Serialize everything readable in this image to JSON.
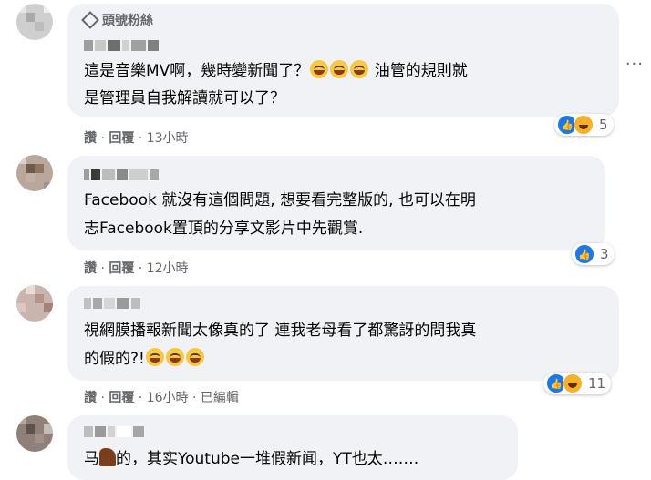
{
  "comments": [
    {
      "badge_label": "頭號粉絲",
      "line1": "這是音樂MV啊，幾時變新聞了？",
      "line1_tail": " 油管的規則就",
      "line2": "是管理員自我解讀就可以了？",
      "like_label": "讚",
      "reply_label": "回覆",
      "time": "13小時",
      "reaction_count": "5"
    },
    {
      "line1": "Facebook 就沒有這個問題, 想要看完整版的, 也可以在明",
      "line2": "志Facebook置頂的分享文影片中先觀賞.",
      "like_label": "讚",
      "reply_label": "回覆",
      "time": "12小時",
      "reaction_count": "3"
    },
    {
      "line1": "視網膜播報新聞太像真的了 連我老母看了都驚訝的問我真",
      "line2": "的假的?!",
      "like_label": "讚",
      "reply_label": "回覆",
      "time": "16小時",
      "edited": "已編輯",
      "reaction_count": "11"
    },
    {
      "line1_a": "马",
      "line1_b": "的，其实Youtube一堆假新闻，YT也太……."
    }
  ],
  "separator": " · ",
  "more_label": "···",
  "icons": {
    "badge": "diamond-icon",
    "like": "like-icon",
    "haha": "haha-icon",
    "emoji": "grinning-sweat-icon",
    "horse": "horse-icon"
  },
  "colors": {
    "bubble": "#f0f2f5",
    "meta": "#65676b",
    "like": "#1877f2"
  }
}
